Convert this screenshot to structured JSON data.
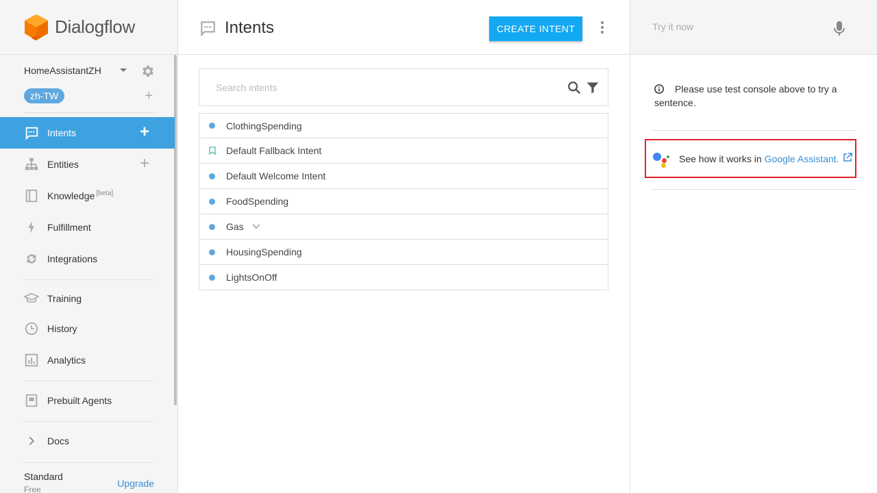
{
  "brand": {
    "name": "Dialogflow",
    "accent": "#3fa2e0"
  },
  "agent": {
    "name": "HomeAssistantZH",
    "language": "zh-TW"
  },
  "sidebar": {
    "items": [
      {
        "label": "Intents",
        "icon": "chat-icon",
        "active": true
      },
      {
        "label": "Entities",
        "icon": "hierarchy-icon"
      },
      {
        "label": "Knowledge",
        "icon": "book-icon",
        "badge": "[beta]"
      },
      {
        "label": "Fulfillment",
        "icon": "bolt-icon"
      },
      {
        "label": "Integrations",
        "icon": "refresh-icon"
      },
      {
        "label": "Training",
        "icon": "graduation-cap-icon"
      },
      {
        "label": "History",
        "icon": "clock-icon"
      },
      {
        "label": "Analytics",
        "icon": "bar-chart-icon"
      },
      {
        "label": "Prebuilt Agents",
        "icon": "agent-book-icon"
      },
      {
        "label": "Docs",
        "icon": "chevron-right-icon"
      }
    ],
    "plan": {
      "name": "Standard",
      "tier": "Free",
      "upgrade_label": "Upgrade"
    }
  },
  "main": {
    "title": "Intents",
    "create_label": "CREATE INTENT",
    "search_placeholder": "Search intents",
    "intents": [
      {
        "name": "ClothingSpending",
        "icon": "dot"
      },
      {
        "name": "Default Fallback Intent",
        "icon": "bookmark"
      },
      {
        "name": "Default Welcome Intent",
        "icon": "dot"
      },
      {
        "name": "FoodSpending",
        "icon": "dot"
      },
      {
        "name": "Gas",
        "icon": "dot",
        "expandable": true
      },
      {
        "name": "HousingSpending",
        "icon": "dot"
      },
      {
        "name": "LightsOnOff",
        "icon": "dot"
      }
    ]
  },
  "right_panel": {
    "try_placeholder": "Try it now",
    "info_text": "Please use test console above to try a sentence.",
    "ga_text": "See how it works in",
    "ga_link": "Google Assistant."
  }
}
